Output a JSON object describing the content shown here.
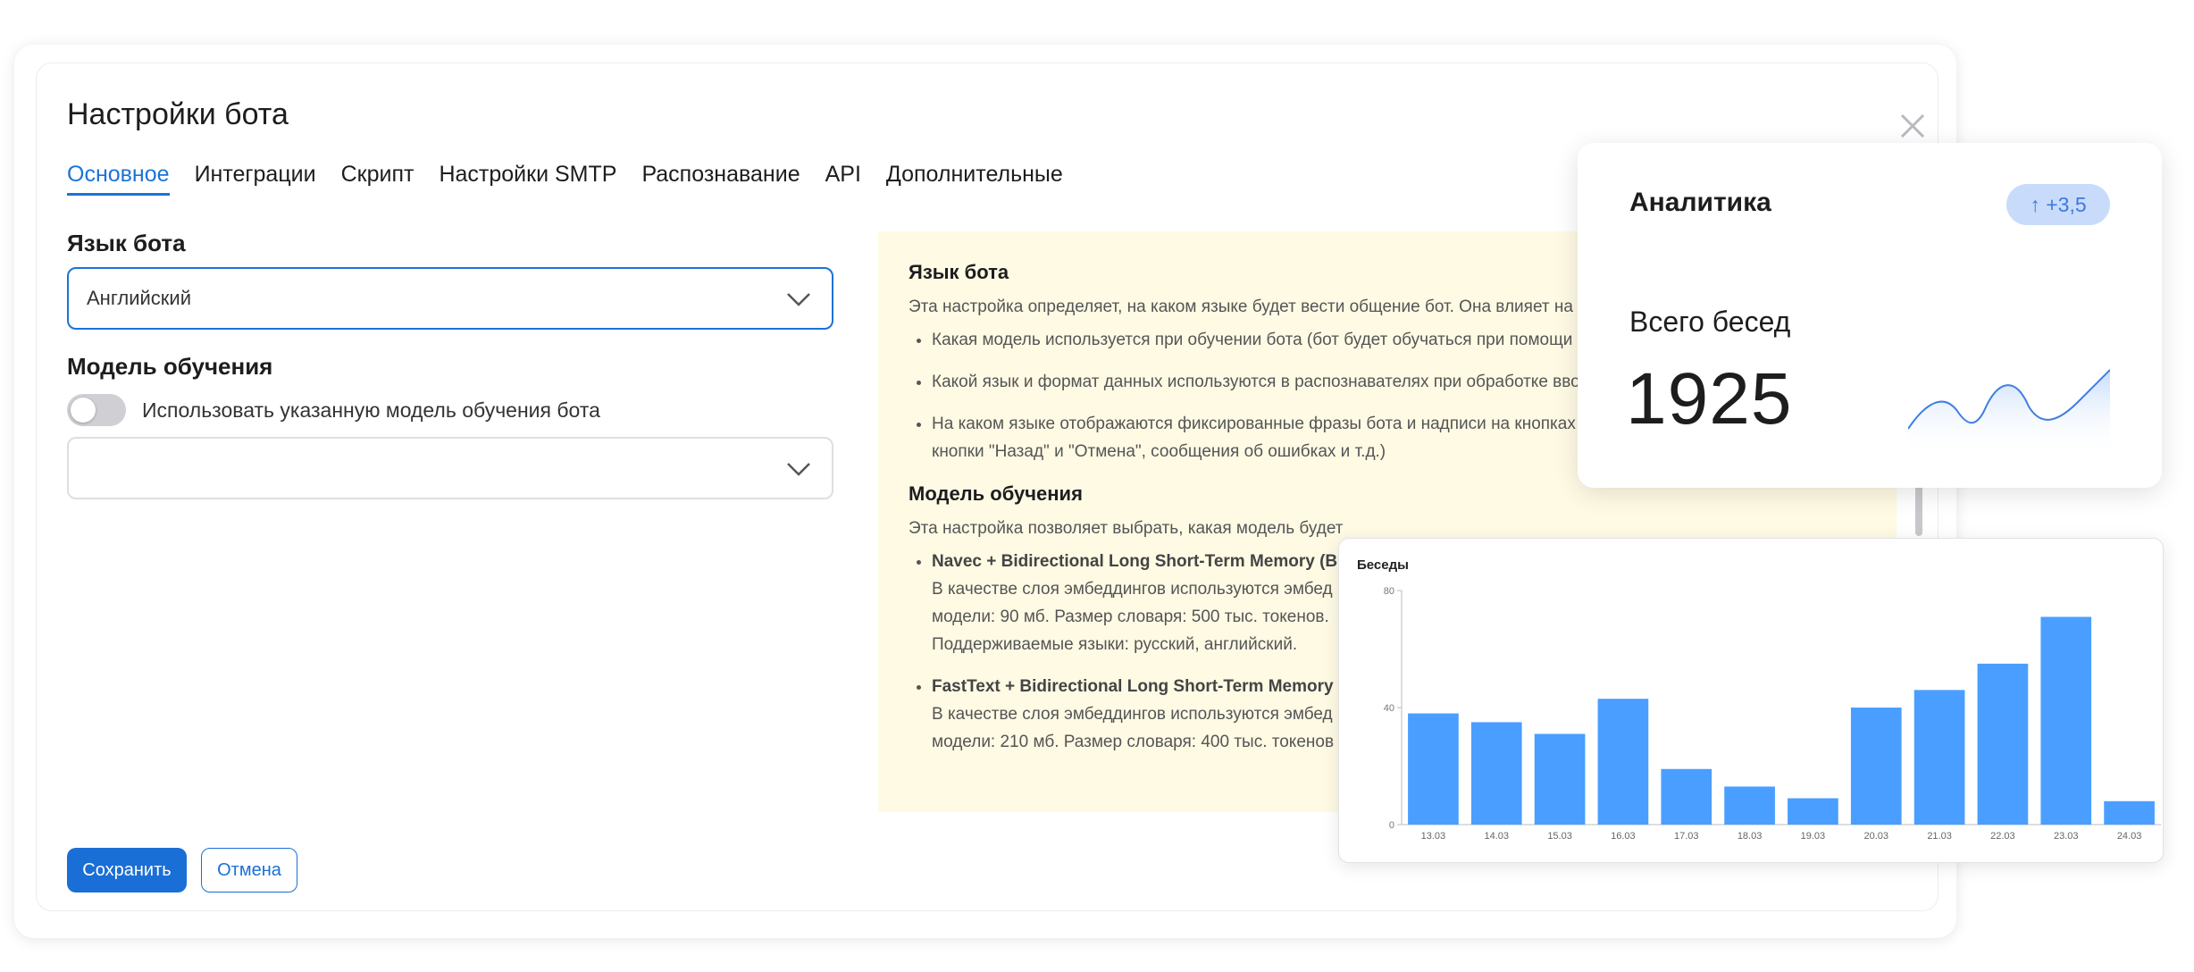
{
  "dialog": {
    "title": "Настройки бота",
    "tabs": [
      {
        "label": "Основное",
        "active": true
      },
      {
        "label": "Интеграции"
      },
      {
        "label": "Скрипт"
      },
      {
        "label": "Настройки SMTP"
      },
      {
        "label": "Распознавание"
      },
      {
        "label": "API"
      },
      {
        "label": "Дополнительные"
      }
    ],
    "language": {
      "label": "Язык бота",
      "value": "Английский"
    },
    "model": {
      "label": "Модель обучения",
      "toggle_label": "Использовать указанную модель обучения бота",
      "toggle_on": false,
      "value": ""
    },
    "help": {
      "h1": "Язык бота",
      "p1": "Эта настройка определяет, на каком языке будет вести общение бот. Она влияет на",
      "bullets": [
        "Какая модель используется при обучении бота (бот будет обучаться при помощи",
        "Какой язык и формат данных используются в распознавателях при обработке вво",
        "На каком языке отображаются фиксированные фразы бота и надписи на кнопках"
      ],
      "bullet3_line2": "кнопки \"Назад\" и \"Отмена\", сообщения об ошибках и т.д.)",
      "h2": "Модель обучения",
      "p2": "Эта настройка позволяет выбрать, какая модель будет",
      "models": [
        {
          "name": "Navec + Bidirectional Long Short-Term Memory (B",
          "line1": "В качестве слоя эмбеддингов используются эмбед",
          "line2": "модели: 90 мб. Размер словаря: 500 тыс. токенов.",
          "line3": "Поддерживаемые языки: русский, английский."
        },
        {
          "name": "FastText + Bidirectional Long Short-Term Memory",
          "line1": "В качестве слоя эмбеддингов используются эмбед",
          "line2": "модели: 210 мб. Размер словаря: 400 тыс. токенов"
        }
      ]
    },
    "buttons": {
      "save": "Сохранить",
      "cancel": "Отмена"
    },
    "icons": {
      "close": "close-icon",
      "chevron": "chevron-down-icon"
    }
  },
  "analytics": {
    "title": "Аналитика",
    "badge": "↑ +3,5",
    "subtitle": "Всего бесед",
    "value": "1925",
    "badge_color": "#c9dbfa"
  },
  "chart_data": {
    "type": "bar",
    "title": "Беседы",
    "categories": [
      "13.03",
      "14.03",
      "15.03",
      "16.03",
      "17.03",
      "18.03",
      "19.03",
      "20.03",
      "21.03",
      "22.03",
      "23.03",
      "24.03"
    ],
    "values": [
      38,
      35,
      31,
      43,
      19,
      13,
      9,
      40,
      46,
      55,
      71,
      8
    ],
    "ylim": [
      0,
      80
    ],
    "yticks": [
      0,
      40,
      80
    ],
    "color": "#4a9eff"
  },
  "colors": {
    "accent": "#1a73d9",
    "help_bg": "#fefae4"
  }
}
